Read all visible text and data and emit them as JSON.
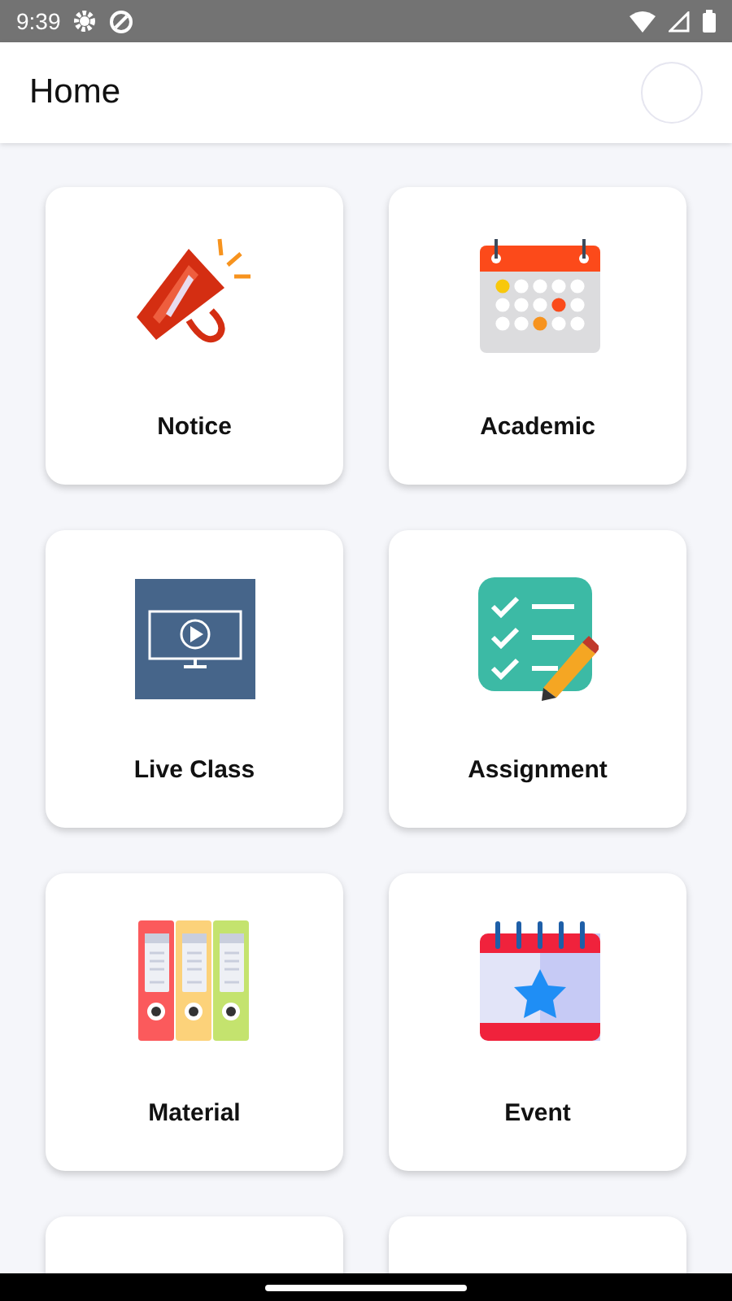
{
  "status_bar": {
    "time": "9:39"
  },
  "header": {
    "title": "Home"
  },
  "cards": [
    {
      "kind": "megaphone",
      "label": "Notice"
    },
    {
      "kind": "calendar",
      "label": "Academic"
    },
    {
      "kind": "monitor",
      "label": "Live Class"
    },
    {
      "kind": "checklist",
      "label": "Assignment"
    },
    {
      "kind": "binders",
      "label": "Material"
    },
    {
      "kind": "star-calendar",
      "label": "Event"
    },
    {
      "kind": "blank"
    },
    {
      "kind": "blank"
    }
  ]
}
